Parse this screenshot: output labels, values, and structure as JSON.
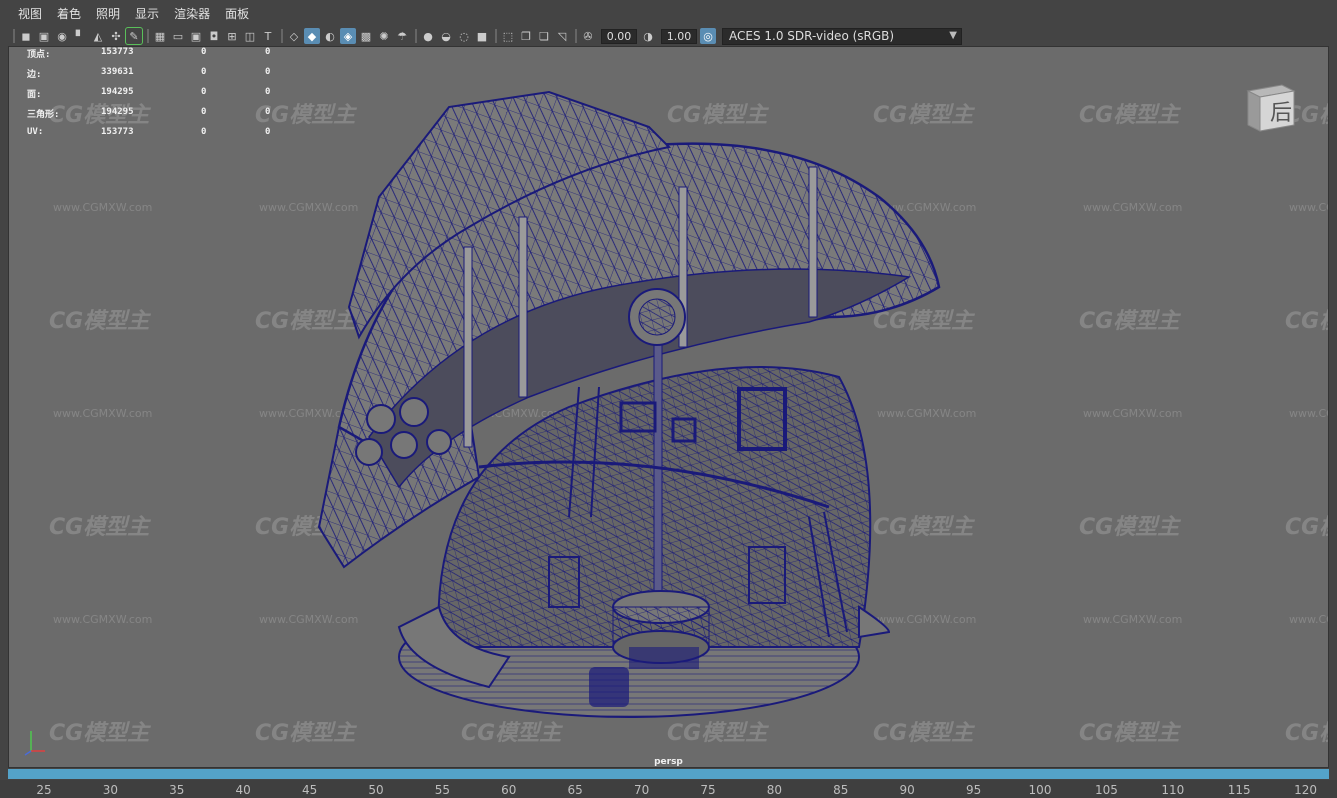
{
  "menu": {
    "items": [
      "视图",
      "着色",
      "照明",
      "显示",
      "渲染器",
      "面板"
    ]
  },
  "toolbar": {
    "exposure_value": "0.00",
    "gamma_value": "1.00",
    "color_management": "ACES 1.0 SDR-video (sRGB)"
  },
  "hud": {
    "rows": [
      {
        "label": "顶点:",
        "v1": "153773",
        "v2": "0",
        "v3": "0"
      },
      {
        "label": "边:",
        "v1": "339631",
        "v2": "0",
        "v3": "0"
      },
      {
        "label": "面:",
        "v1": "194295",
        "v2": "0",
        "v3": "0"
      },
      {
        "label": "三角形:",
        "v1": "194295",
        "v2": "0",
        "v3": "0"
      },
      {
        "label": "UV:",
        "v1": "153773",
        "v2": "0",
        "v3": "0"
      }
    ]
  },
  "viewcube": {
    "label": "后"
  },
  "camera_label": "persp",
  "watermark": {
    "logo": "CG模型主",
    "url": "www.CGMXW.com"
  },
  "timeline": {
    "ticks": [
      "25",
      "30",
      "35",
      "40",
      "45",
      "50",
      "55",
      "60",
      "65",
      "70",
      "75",
      "80",
      "85",
      "90",
      "95",
      "100",
      "105",
      "110",
      "115",
      "120"
    ]
  },
  "colors": {
    "viewport_bg": "#6b6b6b",
    "wireframe": "#1a1a7a",
    "active_tool": "#5a8db3",
    "timeslider": "#54a3c9"
  }
}
